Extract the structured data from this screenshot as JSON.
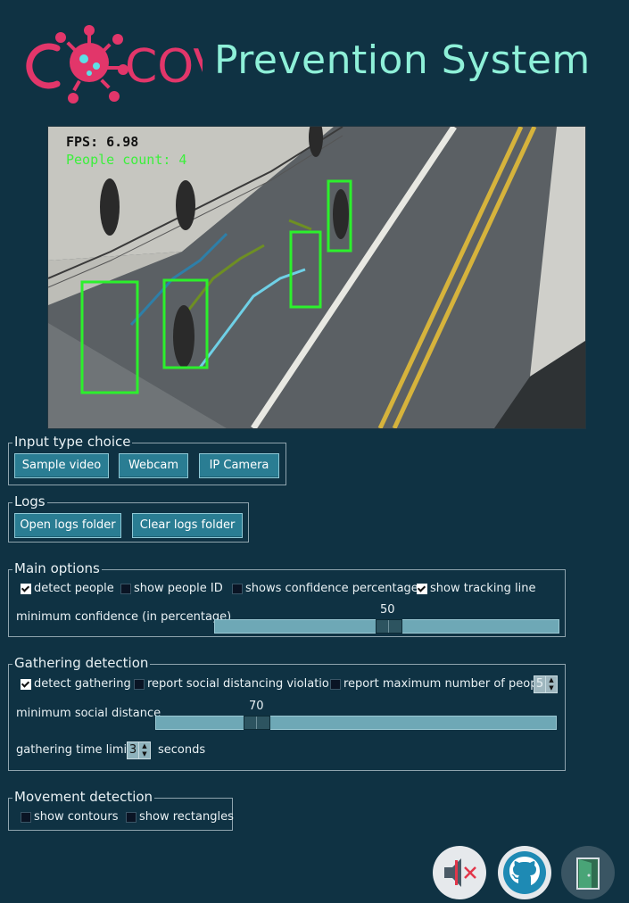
{
  "header": {
    "logo_text": "COVID",
    "title": "Prevention System"
  },
  "video": {
    "fps_label": "FPS: 6.98",
    "people_count_label": "People count: 4"
  },
  "input_type": {
    "legend": "Input type choice",
    "buttons": [
      "Sample video",
      "Webcam",
      "IP Camera"
    ]
  },
  "logs": {
    "legend": "Logs",
    "open_label": "Open logs folder",
    "clear_label": "Clear logs folder"
  },
  "main_options": {
    "legend": "Main options",
    "detect_people": {
      "label": "detect people",
      "checked": true
    },
    "show_people_id": {
      "label": "show people ID",
      "checked": false
    },
    "show_confidence": {
      "label": "shows confidence percentage",
      "checked": false
    },
    "show_tracking": {
      "label": "show tracking line",
      "checked": true
    },
    "min_conf_label": "minimum confidence (in percentage)",
    "min_conf_value": "50",
    "min_conf_fraction": 0.5
  },
  "gathering": {
    "legend": "Gathering detection",
    "detect_gathering": {
      "label": "detect gathering",
      "checked": true
    },
    "report_violation": {
      "label": "report social distancing violation",
      "checked": false
    },
    "report_max": {
      "label": "report maximum number of people:",
      "checked": false
    },
    "max_people_value": "5",
    "min_distance_label": "minimum social distance",
    "min_distance_value": "70",
    "min_distance_fraction": 0.25,
    "time_limit_label": "gathering time limit:",
    "time_limit_value": "3",
    "time_limit_unit": "seconds"
  },
  "movement": {
    "legend": "Movement detection",
    "show_contours": {
      "label": "show contours",
      "checked": false
    },
    "show_rectangles": {
      "label": "show rectangles",
      "checked": false
    }
  },
  "bottom_icons": [
    "mute-icon",
    "github-icon",
    "exit-door-icon"
  ],
  "colors": {
    "background": "#0f3243",
    "accent": "#8ef0d8",
    "logo": "#e2366a",
    "button": "#2a7d93"
  }
}
